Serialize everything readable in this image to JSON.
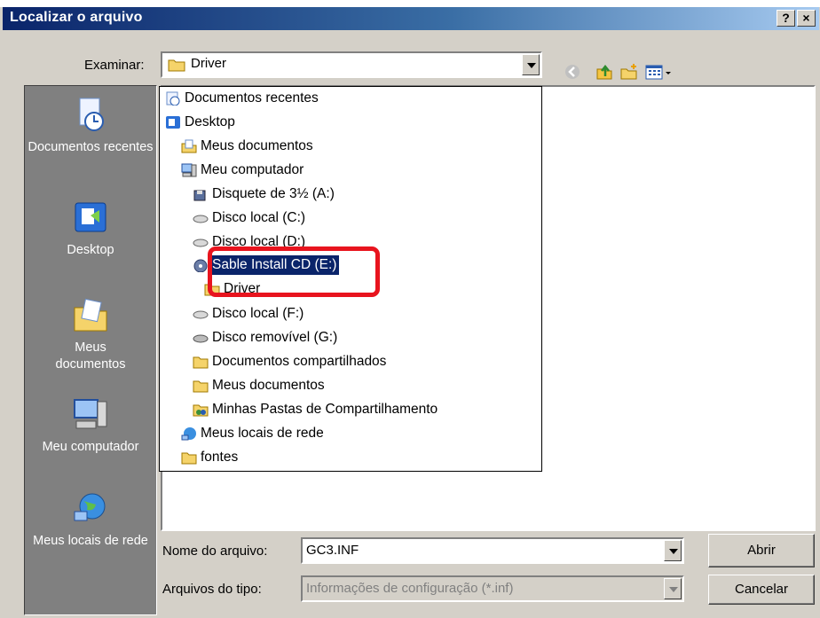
{
  "window": {
    "title": "Localizar o arquivo",
    "help_label": "?",
    "close_label": "×"
  },
  "lookin": {
    "label": "Examinar:",
    "value": "Driver"
  },
  "places": [
    {
      "label": "Documentos recentes"
    },
    {
      "label": "Desktop"
    },
    {
      "label": "Meus documentos"
    },
    {
      "label": "Meu computador"
    },
    {
      "label": "Meus locais de rede"
    }
  ],
  "dropdown_items": [
    {
      "label": "Documentos recentes",
      "icon": "recent-docs-icon"
    },
    {
      "label": "Desktop",
      "icon": "desktop-icon"
    },
    {
      "label": "Meus documentos",
      "icon": "my-documents-icon"
    },
    {
      "label": "Meu computador",
      "icon": "computer-icon"
    },
    {
      "label": "Disquete de 3½ (A:)",
      "icon": "floppy-icon"
    },
    {
      "label": "Disco local (C:)",
      "icon": "drive-icon"
    },
    {
      "label": "Disco local (D:)",
      "icon": "drive-icon"
    },
    {
      "label": "Sable Install CD (E:)",
      "icon": "cd-icon",
      "selected": true
    },
    {
      "label": "Driver",
      "icon": "folder-icon"
    },
    {
      "label": "Disco local (F:)",
      "icon": "drive-icon"
    },
    {
      "label": "Disco removível (G:)",
      "icon": "removable-drive-icon"
    },
    {
      "label": "Documentos compartilhados",
      "icon": "folder-icon"
    },
    {
      "label": "Meus documentos",
      "icon": "folder-icon"
    },
    {
      "label": "Minhas Pastas de Compartilhamento",
      "icon": "shared-folder-icon"
    },
    {
      "label": "Meus locais de rede",
      "icon": "network-icon"
    },
    {
      "label": "fontes",
      "icon": "folder-icon"
    }
  ],
  "filename": {
    "label": "Nome do arquivo:",
    "value": "GC3.INF"
  },
  "filetype": {
    "label": "Arquivos do tipo:",
    "value": "Informações de configuração (*.inf)"
  },
  "buttons": {
    "open": "Abrir",
    "cancel": "Cancelar"
  },
  "colors": {
    "highlight_box": "#e8141e",
    "selection": "#0a246a",
    "titlebar": "#0a246a"
  }
}
